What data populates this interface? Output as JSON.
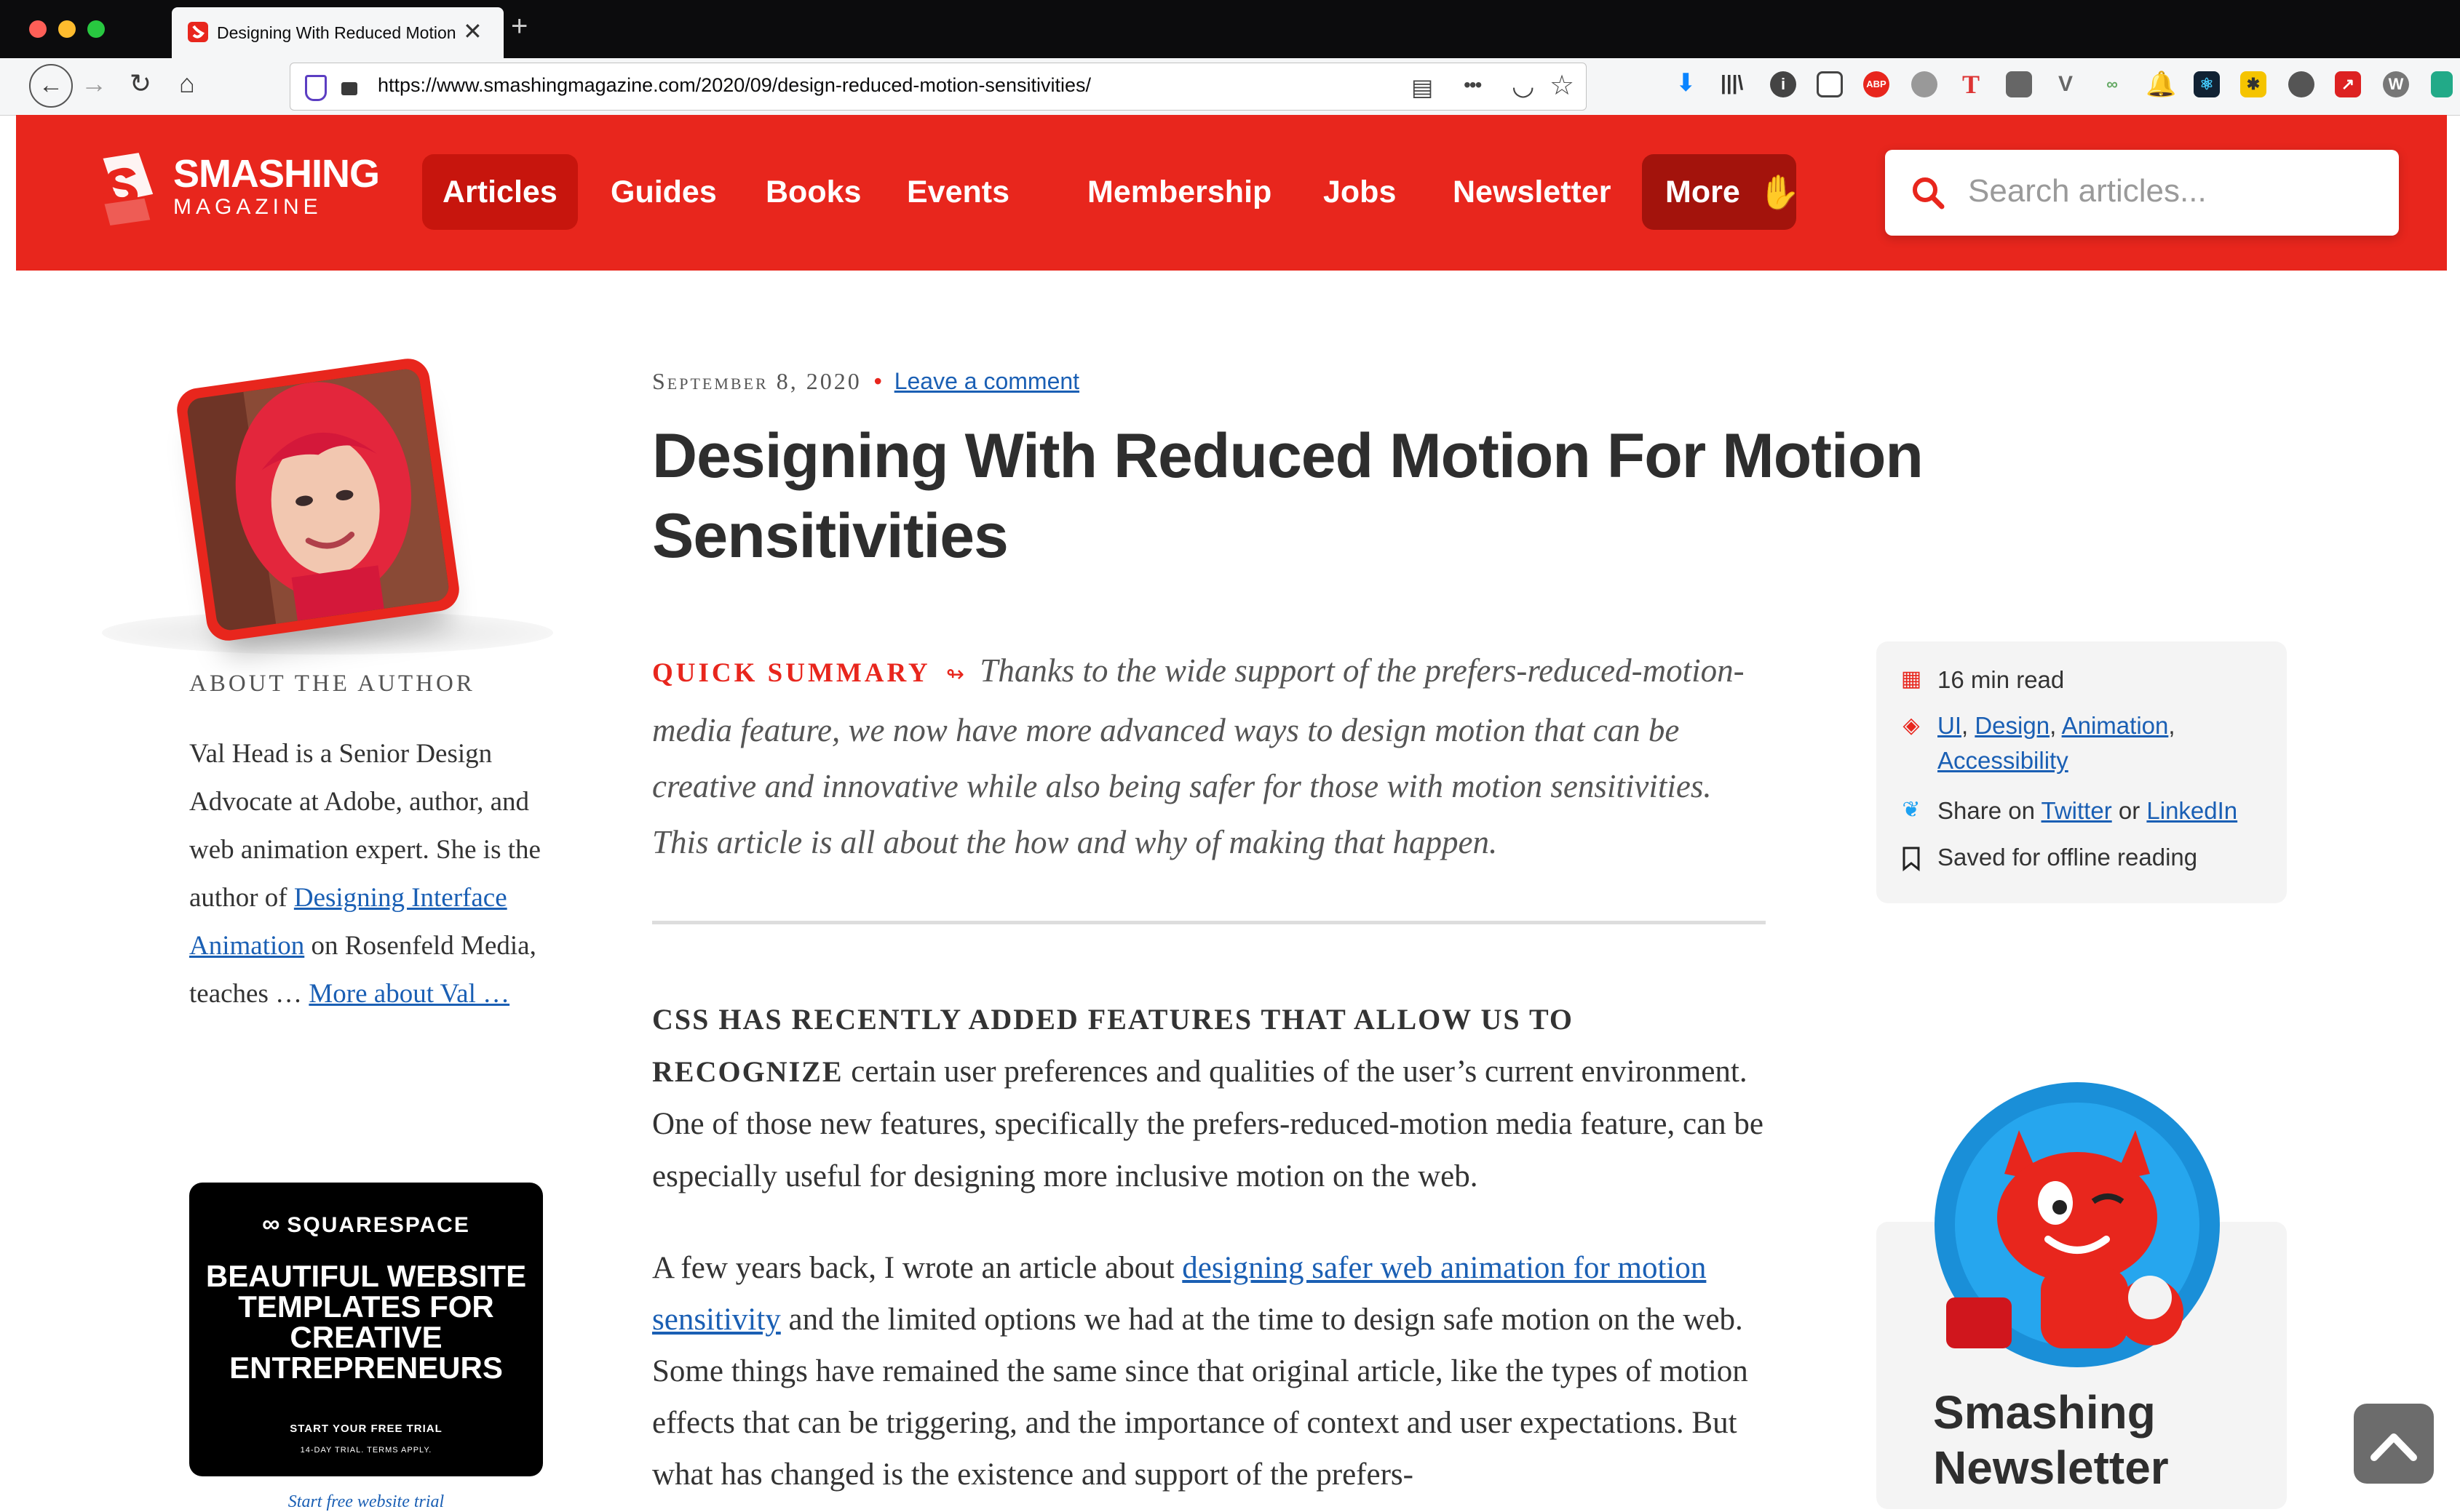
{
  "browser": {
    "tab_title": "Designing With Reduced Motion",
    "url": "https://www.smashingmagazine.com/2020/09/design-reduced-motion-sensitivities/",
    "new_tab": "+",
    "tab_close": "✕",
    "back": "←",
    "forward": "→",
    "reload": "↻",
    "home": "⌂",
    "reader_icon": "▤",
    "menu_icon": "•••",
    "pocket_icon": "◡",
    "bookmark_icon": "☆",
    "download_icon": "⬇",
    "library_icon": "|||\\",
    "extensions": [
      "ABP",
      "T",
      "V",
      "W"
    ]
  },
  "site": {
    "logo": {
      "line1": "SMASHING",
      "line2": "MAGAZINE"
    },
    "nav": [
      "Articles",
      "Guides",
      "Books",
      "Events",
      "Membership",
      "Jobs",
      "Newsletter"
    ],
    "nav_more": "More",
    "search_placeholder": "Search articles..."
  },
  "author": {
    "heading": "ABOUT THE AUTHOR",
    "bio_1": "Val Head is a Senior Design Advocate at Adobe, author, and web animation expert. She is the author of",
    "bio_link": "Designing Interface Animation",
    "bio_2": "on Rosenfeld Media, teaches …",
    "more_link": "More about Val …"
  },
  "ad": {
    "brand": "SQUARESPACE",
    "headline": "BEAUTIFUL WEBSITE TEMPLATES FOR CREATIVE ENTREPRENEURS",
    "cta": "START YOUR FREE TRIAL",
    "sub": "14-DAY TRIAL. TERMS APPLY.",
    "caption": "Start free website trial"
  },
  "article": {
    "date": "September 8, 2020",
    "bullet": "•",
    "comment_link": "Leave a comment",
    "title": "Designing With Reduced Motion For Motion Sensitivities",
    "summary_label": "Quick summary",
    "summary_arrow": "↬",
    "summary": "Thanks to the wide support of the prefers-reduced-motion-media feature, we now have more advanced ways to design motion that can be creative and innovative while also being safer for those with motion sensitivities. This article is all about the how and why of making that happen.",
    "lead_caps": "CSS HAS RECENTLY ADDED FEATURES THAT ALLOW US TO RECOGNIZE",
    "lead_rest": "certain user preferences and qualities of the user’s current environment. One of those new features, specifically the prefers-reduced-motion media feature, can be especially useful for designing more inclusive motion on the web.",
    "p2_start": "A few years back, I wrote an article about",
    "p2_link": "designing safer web animation for motion sensitivity",
    "p2_rest": "and the limited options we had at the time to design safe motion on the web. Some things have remained the same since that original article, like the types of motion effects that can be triggering, and the importance of context and user expectations. But what has changed is the existence and support of the prefers-"
  },
  "sidebar": {
    "read_time": "16 min read",
    "tags": [
      "UI",
      "Design",
      "Animation",
      "Accessibility"
    ],
    "share_label": "Share on",
    "share_twitter": "Twitter",
    "share_or": "or",
    "share_linkedin": "LinkedIn",
    "saved": "Saved for offline reading",
    "newsletter_title_1": "Smashing",
    "newsletter_title_2": "Newsletter"
  },
  "colors": {
    "brand_red": "#e8261d",
    "link_blue": "#1a5fb4",
    "browser_dark": "#0c0c0d"
  }
}
